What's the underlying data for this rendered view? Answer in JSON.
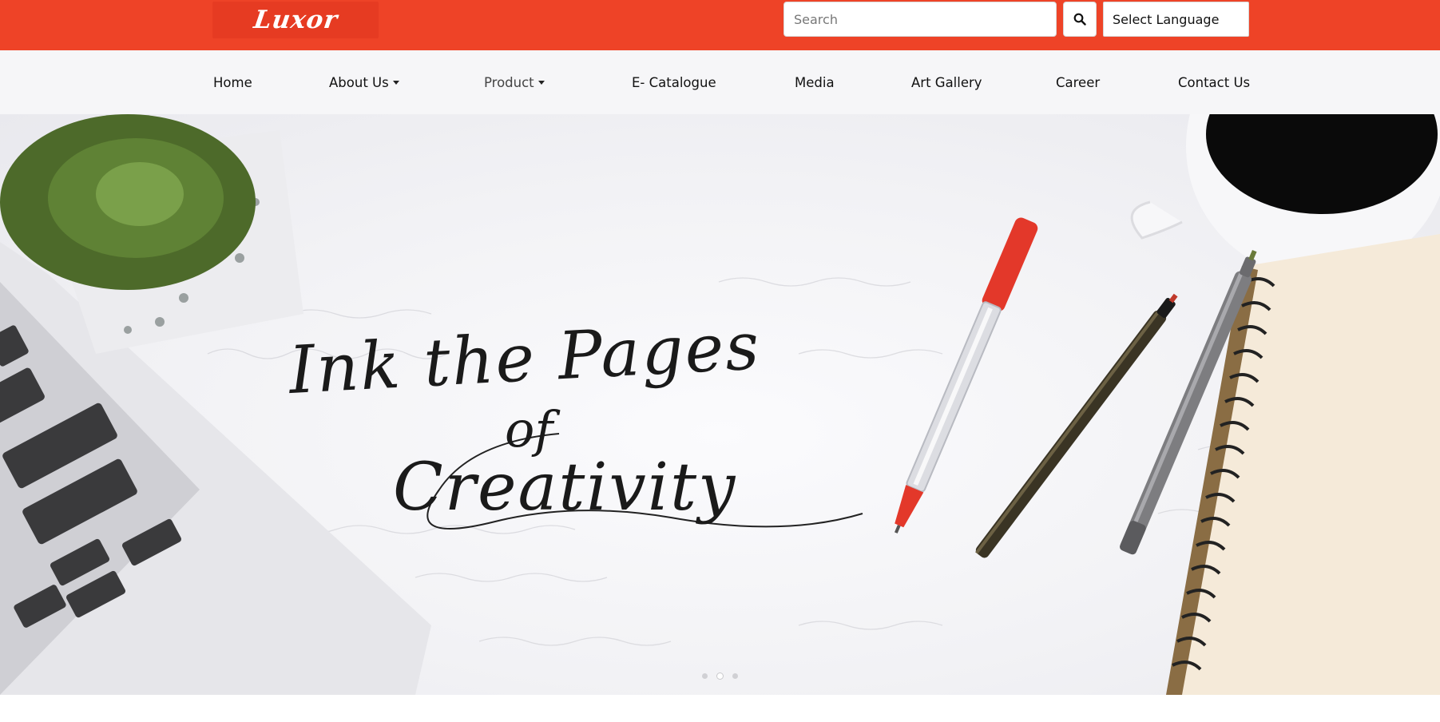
{
  "brand": {
    "logo_text": "Luxor",
    "accent": "#ee4327"
  },
  "search": {
    "placeholder": "Search",
    "value": ""
  },
  "language": {
    "selected": "Select Language"
  },
  "nav": {
    "home": "Home",
    "about": "About Us",
    "product": "Product",
    "catalogue": "E- Catalogue",
    "media": "Media",
    "gallery": "Art Gallery",
    "career": "Career",
    "contact": "Contact Us"
  },
  "hero": {
    "line1": "Ink the Pages",
    "line2": "of",
    "line3": "Creativity",
    "slides": 3,
    "active_slide": 2
  },
  "icons": [
    "search-icon",
    "caret-down-icon"
  ]
}
